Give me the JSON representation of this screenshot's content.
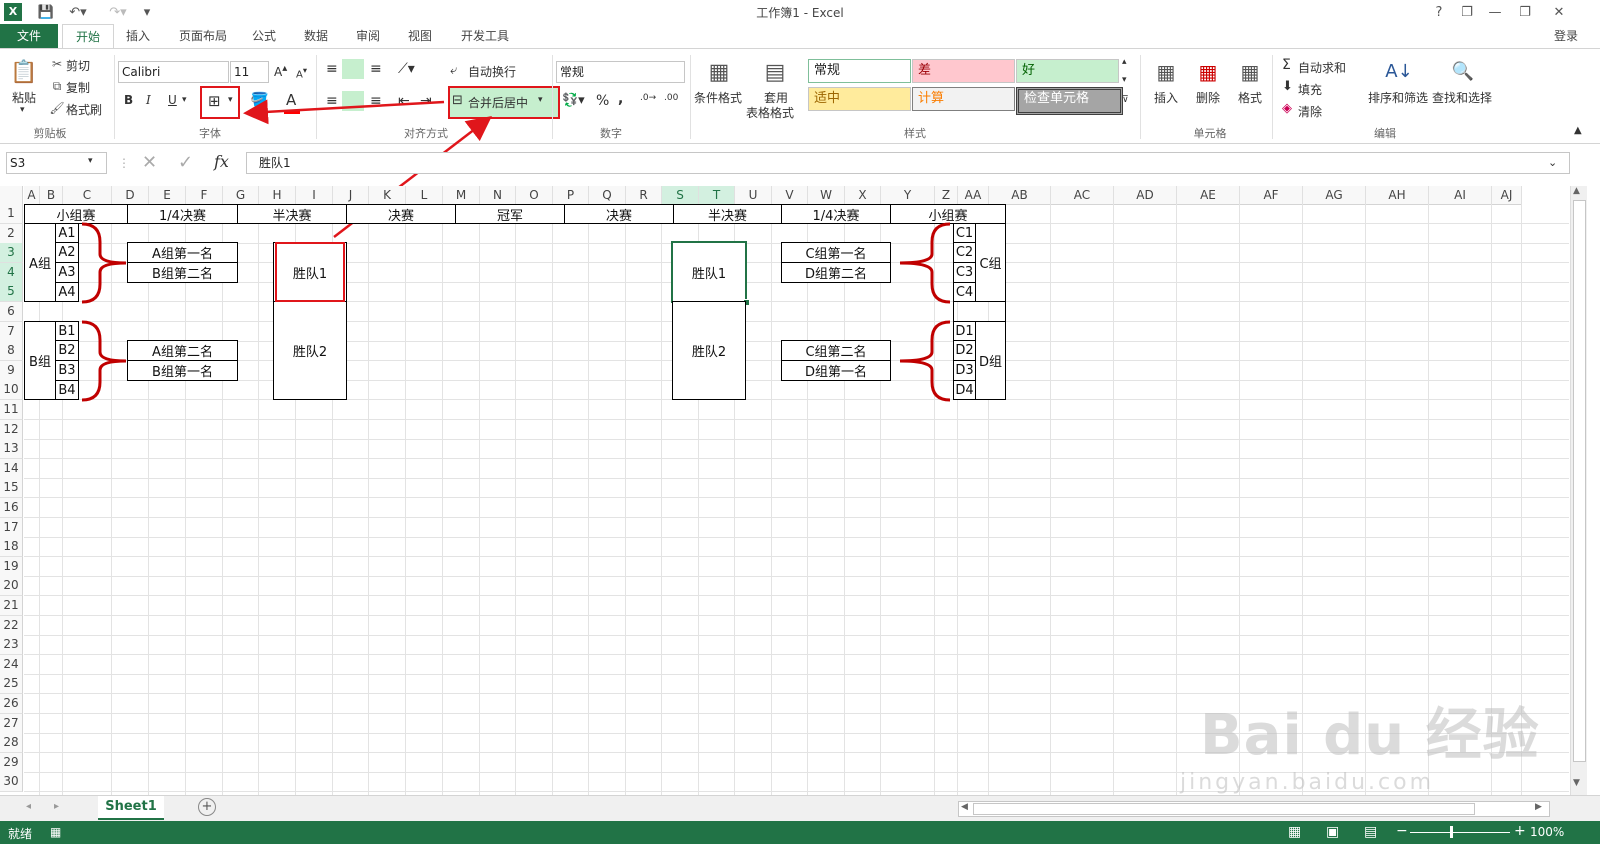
{
  "window": {
    "title": "工作簿1 - Excel",
    "controls": [
      "?",
      "❐",
      "—",
      "❐",
      "✕"
    ],
    "signin": "登录"
  },
  "tabs": [
    "文件",
    "开始",
    "插入",
    "页面布局",
    "公式",
    "数据",
    "审阅",
    "视图",
    "开发工具"
  ],
  "active_tab": "开始",
  "ribbon": {
    "clipboard": {
      "paste": "粘贴",
      "cut": "剪切",
      "copy": "复制",
      "format_painter": "格式刷",
      "group": "剪贴板"
    },
    "font": {
      "name": "Calibri",
      "size": "11",
      "bold": "B",
      "italic": "I",
      "underline": "U",
      "group": "字体"
    },
    "alignment": {
      "wrap": "自动换行",
      "merge": "合并后居中",
      "group": "对齐方式"
    },
    "number": {
      "format": "常规",
      "percent": "%",
      "comma": ",",
      "group": "数字"
    },
    "styles": {
      "conditional": "条件格式",
      "table_format_1": "套用",
      "table_format_2": "表格格式",
      "normal": "常规",
      "bad": "差",
      "good": "好",
      "neutral": "适中",
      "calc": "计算",
      "check": "检查单元格",
      "group": "样式"
    },
    "cells": {
      "insert": "插入",
      "delete": "删除",
      "format": "格式",
      "group": "单元格"
    },
    "editing": {
      "autosum": "自动求和",
      "fill": "填充",
      "clear": "清除",
      "sort": "排序和筛选",
      "find": "查找和选择",
      "group": "编辑"
    }
  },
  "formula_bar": {
    "name_box": "S3",
    "fx": "fx",
    "content": "胜队1"
  },
  "columns": [
    "A",
    "B",
    "C",
    "D",
    "E",
    "F",
    "G",
    "H",
    "I",
    "J",
    "K",
    "L",
    "M",
    "N",
    "O",
    "P",
    "Q",
    "R",
    "S",
    "T",
    "U",
    "V",
    "W",
    "X",
    "Y",
    "Z",
    "AA",
    "AB",
    "AC",
    "AD",
    "AE",
    "AF",
    "AG",
    "AH",
    "AI",
    "AJ"
  ],
  "rows": [
    "1",
    "2",
    "3",
    "4",
    "5",
    "6",
    "7",
    "8",
    "9",
    "10",
    "11",
    "12",
    "13",
    "14",
    "15",
    "16",
    "17",
    "18",
    "19",
    "20",
    "21",
    "22",
    "23",
    "24",
    "25",
    "26",
    "27",
    "28",
    "29",
    "30"
  ],
  "sheet": {
    "headers": [
      "小组赛",
      "1/4决赛",
      "半决赛",
      "决赛",
      "冠军",
      "决赛",
      "半决赛",
      "1/4决赛",
      "小组赛"
    ],
    "groups": {
      "a": "A组",
      "b": "B组",
      "c": "C组",
      "d": "D组"
    },
    "left_a": [
      "A1",
      "A2",
      "A3",
      "A4"
    ],
    "left_b": [
      "B1",
      "B2",
      "B3",
      "B4"
    ],
    "right_c": [
      "C1",
      "C2",
      "C3",
      "C4"
    ],
    "right_d": [
      "D1",
      "D2",
      "D3",
      "D4"
    ],
    "qf_left_top": [
      "A组第一名",
      "B组第二名"
    ],
    "qf_left_bottom": [
      "A组第二名",
      "B组第一名"
    ],
    "qf_right_top": [
      "C组第一名",
      "D组第二名"
    ],
    "qf_right_bottom": [
      "C组第二名",
      "D组第一名"
    ],
    "semi_left": [
      "胜队1",
      "胜队2"
    ],
    "semi_right": [
      "胜队1",
      "胜队2"
    ]
  },
  "sheet_tabs": {
    "active": "Sheet1",
    "add": "+"
  },
  "status": {
    "ready": "就绪",
    "zoom": "100%"
  },
  "watermark": {
    "brand": "Bai du 经验",
    "url": "jingyan.baidu.com"
  },
  "colors": {
    "excel_green": "#217346",
    "annotation_red": "#e0161b",
    "brace_red": "#c00000"
  }
}
